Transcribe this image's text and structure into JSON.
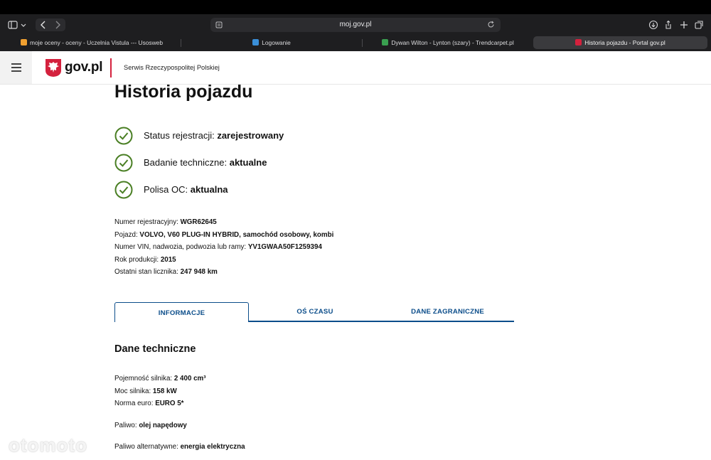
{
  "browser": {
    "address": "moj.gov.pl",
    "tabs": [
      {
        "label": "moje oceny - oceny - Uczelnia Vistula --- Usosweb",
        "favicon_color": "#f0a030"
      },
      {
        "label": "Logowanie",
        "favicon_color": "#3a8fd8"
      },
      {
        "label": "Dywan Wilton - Lynton (szary) - Trendcarpet.pl",
        "favicon_color": "#3aa050"
      },
      {
        "label": "Historia pojazdu - Portal gov.pl",
        "favicon_color": "#d4213d"
      }
    ]
  },
  "header": {
    "logo_text": "gov.pl",
    "service": "Serwis Rzeczypospolitej Polskiej"
  },
  "page": {
    "title": "Historia pojazdu",
    "statuses": [
      {
        "label": "Status rejestracji:",
        "value": "zarejestrowany"
      },
      {
        "label": "Badanie techniczne:",
        "value": "aktualne"
      },
      {
        "label": "Polisa OC:",
        "value": "aktualna"
      }
    ],
    "vehicle": [
      {
        "label": "Numer rejestracyjny:",
        "value": "WGR62645"
      },
      {
        "label": "Pojazd:",
        "value": "VOLVO, V60 PLUG-IN HYBRID, samochód osobowy, kombi"
      },
      {
        "label": "Numer VIN, nadwozia, podwozia lub ramy:",
        "value": "YV1GWAA50F1259394"
      },
      {
        "label": "Rok produkcji:",
        "value": "2015"
      },
      {
        "label": "Ostatni stan licznika:",
        "value": "247 948 km"
      }
    ],
    "tabs": [
      "INFORMACJE",
      "OŚ CZASU",
      "DANE ZAGRANICZNE"
    ],
    "section_title": "Dane techniczne",
    "technical": [
      {
        "label": "Pojemność silnika:",
        "value": "2 400 cm³"
      },
      {
        "label": "Moc silnika:",
        "value": "158 kW"
      },
      {
        "label": "Norma euro:",
        "value": "EURO 5*"
      },
      {
        "label": "Paliwo:",
        "value": "olej napędowy"
      },
      {
        "label": "Paliwo alternatywne:",
        "value": "energia elektryczna"
      }
    ]
  },
  "watermark": "otomoto",
  "colors": {
    "accent_blue": "#0b4d8a",
    "check_green": "#4a7f24",
    "brand_red": "#d4213d"
  }
}
